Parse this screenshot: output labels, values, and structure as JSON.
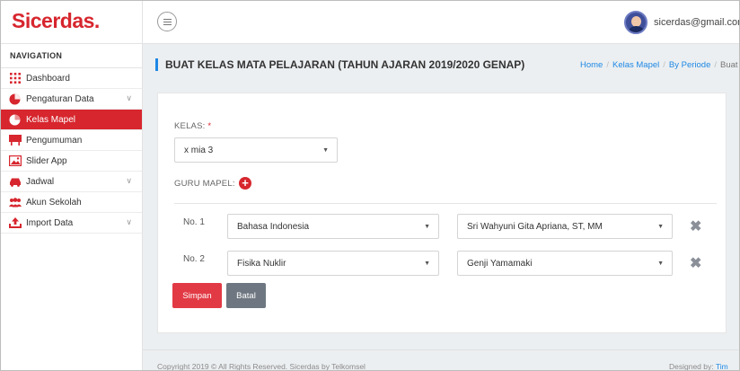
{
  "header": {
    "brand": "Sicerdas.",
    "user_email": "sicerdas@gmail.com"
  },
  "sidebar": {
    "title": "NAVIGATION",
    "items": [
      {
        "label": "Dashboard",
        "icon": "grid-icon",
        "has_submenu": false,
        "active": false
      },
      {
        "label": "Pengaturan Data",
        "icon": "pie-chart-icon",
        "has_submenu": true,
        "active": false
      },
      {
        "label": "Kelas Mapel",
        "icon": "pie-chart-icon",
        "has_submenu": false,
        "active": true
      },
      {
        "label": "Pengumuman",
        "icon": "billboard-icon",
        "has_submenu": false,
        "active": false
      },
      {
        "label": "Slider App",
        "icon": "image-icon",
        "has_submenu": false,
        "active": false
      },
      {
        "label": "Jadwal",
        "icon": "car-icon",
        "has_submenu": true,
        "active": false
      },
      {
        "label": "Akun Sekolah",
        "icon": "users-icon",
        "has_submenu": false,
        "active": false
      },
      {
        "label": "Import Data",
        "icon": "upload-icon",
        "has_submenu": true,
        "active": false
      }
    ]
  },
  "page": {
    "title": "BUAT KELAS MATA PELAJARAN (TAHUN AJARAN 2019/2020 GENAP)",
    "breadcrumb": [
      "Home",
      "Kelas Mapel",
      "By Periode",
      "Buat Kelas"
    ]
  },
  "form": {
    "kelas_label": "KELAS:",
    "required_mark": "*",
    "kelas_value": "x mia 3",
    "guru_label": "GURU MAPEL:",
    "rows": [
      {
        "no": "No. 1",
        "mapel": "Bahasa Indonesia",
        "guru": "Sri Wahyuni Gita Apriana, ST, MM"
      },
      {
        "no": "No. 2",
        "mapel": "Fisika Nuklir",
        "guru": "Genji Yamamaki"
      }
    ],
    "save_label": "Simpan",
    "cancel_label": "Batal"
  },
  "footer": {
    "copyright": "Copyright 2019 © All Rights Reserved. Sicerdas by Telkomsel",
    "designed_prefix": "Designed by:",
    "designed_by": "Tim"
  },
  "colors": {
    "brand": "#d7262e",
    "accent": "#1e88e5",
    "save": "#e23a45",
    "cancel": "#6e7781"
  }
}
